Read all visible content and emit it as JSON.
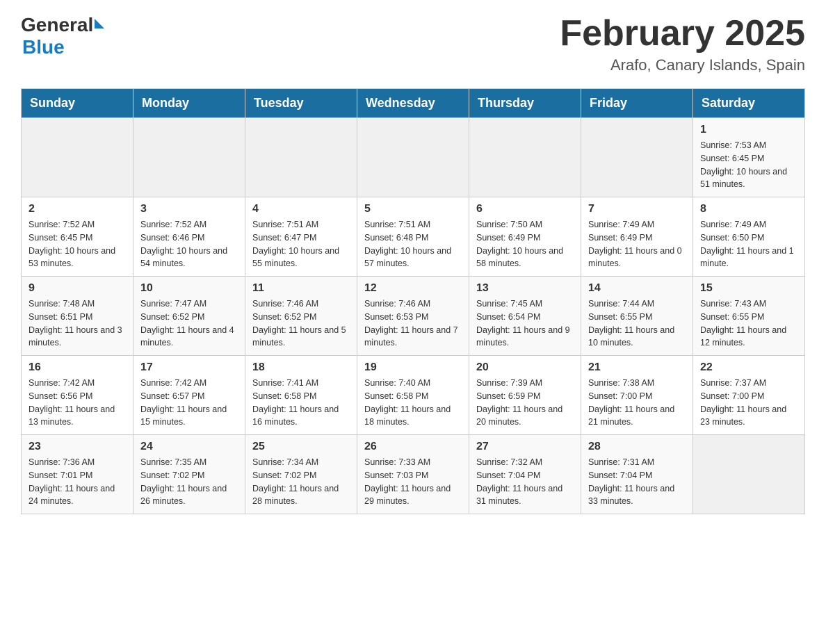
{
  "header": {
    "logo": {
      "general": "General",
      "blue": "Blue"
    },
    "title": "February 2025",
    "subtitle": "Arafo, Canary Islands, Spain"
  },
  "days_of_week": [
    "Sunday",
    "Monday",
    "Tuesday",
    "Wednesday",
    "Thursday",
    "Friday",
    "Saturday"
  ],
  "weeks": [
    [
      {
        "day": "",
        "info": ""
      },
      {
        "day": "",
        "info": ""
      },
      {
        "day": "",
        "info": ""
      },
      {
        "day": "",
        "info": ""
      },
      {
        "day": "",
        "info": ""
      },
      {
        "day": "",
        "info": ""
      },
      {
        "day": "1",
        "info": "Sunrise: 7:53 AM\nSunset: 6:45 PM\nDaylight: 10 hours and 51 minutes."
      }
    ],
    [
      {
        "day": "2",
        "info": "Sunrise: 7:52 AM\nSunset: 6:45 PM\nDaylight: 10 hours and 53 minutes."
      },
      {
        "day": "3",
        "info": "Sunrise: 7:52 AM\nSunset: 6:46 PM\nDaylight: 10 hours and 54 minutes."
      },
      {
        "day": "4",
        "info": "Sunrise: 7:51 AM\nSunset: 6:47 PM\nDaylight: 10 hours and 55 minutes."
      },
      {
        "day": "5",
        "info": "Sunrise: 7:51 AM\nSunset: 6:48 PM\nDaylight: 10 hours and 57 minutes."
      },
      {
        "day": "6",
        "info": "Sunrise: 7:50 AM\nSunset: 6:49 PM\nDaylight: 10 hours and 58 minutes."
      },
      {
        "day": "7",
        "info": "Sunrise: 7:49 AM\nSunset: 6:49 PM\nDaylight: 11 hours and 0 minutes."
      },
      {
        "day": "8",
        "info": "Sunrise: 7:49 AM\nSunset: 6:50 PM\nDaylight: 11 hours and 1 minute."
      }
    ],
    [
      {
        "day": "9",
        "info": "Sunrise: 7:48 AM\nSunset: 6:51 PM\nDaylight: 11 hours and 3 minutes."
      },
      {
        "day": "10",
        "info": "Sunrise: 7:47 AM\nSunset: 6:52 PM\nDaylight: 11 hours and 4 minutes."
      },
      {
        "day": "11",
        "info": "Sunrise: 7:46 AM\nSunset: 6:52 PM\nDaylight: 11 hours and 5 minutes."
      },
      {
        "day": "12",
        "info": "Sunrise: 7:46 AM\nSunset: 6:53 PM\nDaylight: 11 hours and 7 minutes."
      },
      {
        "day": "13",
        "info": "Sunrise: 7:45 AM\nSunset: 6:54 PM\nDaylight: 11 hours and 9 minutes."
      },
      {
        "day": "14",
        "info": "Sunrise: 7:44 AM\nSunset: 6:55 PM\nDaylight: 11 hours and 10 minutes."
      },
      {
        "day": "15",
        "info": "Sunrise: 7:43 AM\nSunset: 6:55 PM\nDaylight: 11 hours and 12 minutes."
      }
    ],
    [
      {
        "day": "16",
        "info": "Sunrise: 7:42 AM\nSunset: 6:56 PM\nDaylight: 11 hours and 13 minutes."
      },
      {
        "day": "17",
        "info": "Sunrise: 7:42 AM\nSunset: 6:57 PM\nDaylight: 11 hours and 15 minutes."
      },
      {
        "day": "18",
        "info": "Sunrise: 7:41 AM\nSunset: 6:58 PM\nDaylight: 11 hours and 16 minutes."
      },
      {
        "day": "19",
        "info": "Sunrise: 7:40 AM\nSunset: 6:58 PM\nDaylight: 11 hours and 18 minutes."
      },
      {
        "day": "20",
        "info": "Sunrise: 7:39 AM\nSunset: 6:59 PM\nDaylight: 11 hours and 20 minutes."
      },
      {
        "day": "21",
        "info": "Sunrise: 7:38 AM\nSunset: 7:00 PM\nDaylight: 11 hours and 21 minutes."
      },
      {
        "day": "22",
        "info": "Sunrise: 7:37 AM\nSunset: 7:00 PM\nDaylight: 11 hours and 23 minutes."
      }
    ],
    [
      {
        "day": "23",
        "info": "Sunrise: 7:36 AM\nSunset: 7:01 PM\nDaylight: 11 hours and 24 minutes."
      },
      {
        "day": "24",
        "info": "Sunrise: 7:35 AM\nSunset: 7:02 PM\nDaylight: 11 hours and 26 minutes."
      },
      {
        "day": "25",
        "info": "Sunrise: 7:34 AM\nSunset: 7:02 PM\nDaylight: 11 hours and 28 minutes."
      },
      {
        "day": "26",
        "info": "Sunrise: 7:33 AM\nSunset: 7:03 PM\nDaylight: 11 hours and 29 minutes."
      },
      {
        "day": "27",
        "info": "Sunrise: 7:32 AM\nSunset: 7:04 PM\nDaylight: 11 hours and 31 minutes."
      },
      {
        "day": "28",
        "info": "Sunrise: 7:31 AM\nSunset: 7:04 PM\nDaylight: 11 hours and 33 minutes."
      },
      {
        "day": "",
        "info": ""
      }
    ]
  ]
}
